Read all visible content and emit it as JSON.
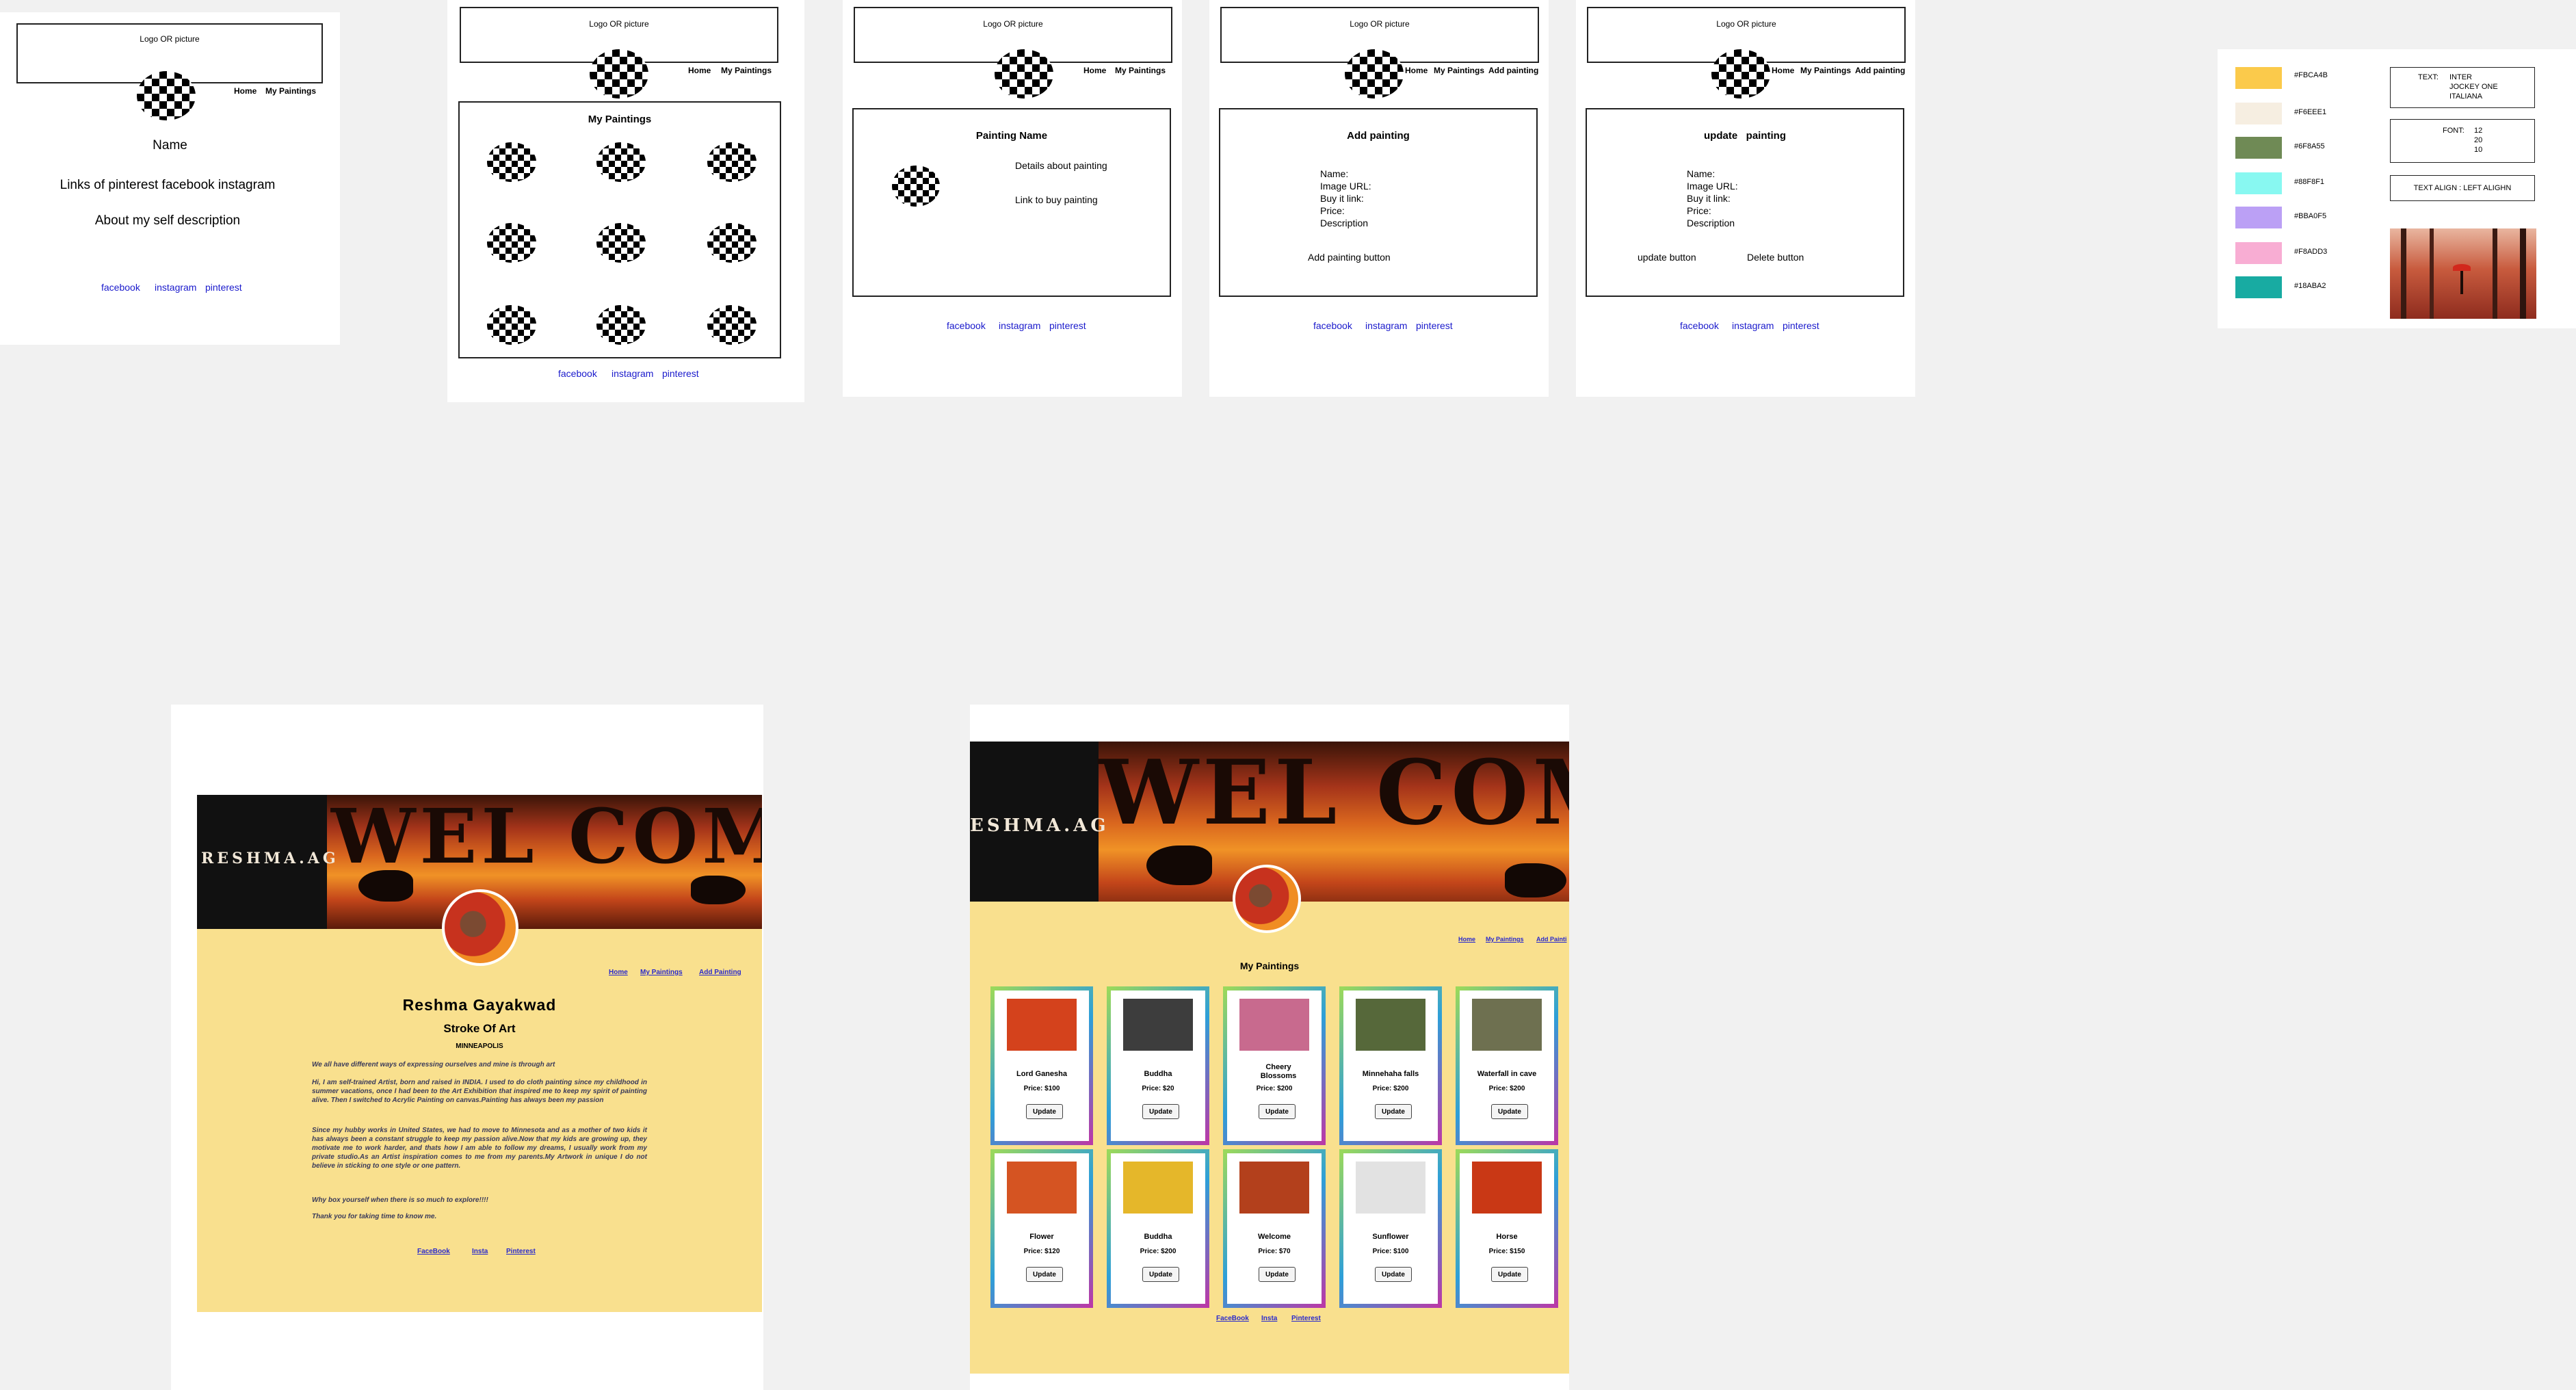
{
  "wire1": {
    "logo": "Logo OR picture",
    "nav": [
      "Home",
      "My Paintings"
    ],
    "name": "Name",
    "links_line": "Links of pinterest  facebook   instagram",
    "about": "About my self description",
    "footer": [
      "facebook",
      "instagram",
      "pinterest"
    ]
  },
  "wire2": {
    "logo": "Logo OR picture",
    "nav": [
      "Home",
      "My Paintings"
    ],
    "title": "My Paintings",
    "footer": [
      "facebook",
      "instagram",
      "pinterest"
    ]
  },
  "wire3": {
    "logo": "Logo OR picture",
    "nav": [
      "Home",
      "My Paintings"
    ],
    "title": "Painting  Name",
    "details": "Details about painting",
    "buy": "Link to buy painting",
    "footer": [
      "facebook",
      "instagram",
      "pinterest"
    ]
  },
  "wire4": {
    "logo": "Logo OR picture",
    "nav": [
      "Home",
      "My Paintings",
      "Add painting"
    ],
    "title": "Add painting",
    "fields": [
      "Name:",
      "Image URL:",
      "Buy it link:",
      "Price:",
      "Description"
    ],
    "button": "Add painting button",
    "footer": [
      "facebook",
      "instagram",
      "pinterest"
    ]
  },
  "wire5": {
    "logo": "Logo OR picture",
    "nav": [
      "Home",
      "My Paintings",
      "Add painting"
    ],
    "title": "update   painting",
    "fields": [
      "Name:",
      "Image URL:",
      "Buy it link:",
      "Price:",
      "Description"
    ],
    "update_button": "update button",
    "delete_button": "Delete button",
    "footer": [
      "facebook",
      "instagram",
      "pinterest"
    ]
  },
  "style_guide": {
    "colors": [
      {
        "hex": "#FBCA4B",
        "label": "#FBCA4B"
      },
      {
        "hex": "#F6EEE1",
        "label": "#F6EEE1"
      },
      {
        "hex": "#6F8A55",
        "label": "#6F8A55"
      },
      {
        "hex": "#88F8F1",
        "label": "#88F8F1"
      },
      {
        "hex": "#BBA0F5",
        "label": "#BBA0F5"
      },
      {
        "hex": "#F8ADD3",
        "label": "#F8ADD3"
      },
      {
        "hex": "#18ABA2",
        "label": "#18ABA2"
      }
    ],
    "text_box": {
      "label": "TEXT:",
      "lines": [
        "INTER",
        "JOCKEY ONE",
        "ITALIANA"
      ]
    },
    "font_box": {
      "label": "FONT:",
      "sizes": [
        "12",
        "20",
        "10"
      ]
    },
    "align_box": "TEXT ALIGN : LEFT ALIGHN"
  },
  "home_mock": {
    "bg": "#F9E08E",
    "brand": "RESHMA.AG",
    "welcome": "WEL COME",
    "nav": [
      "Home",
      "My Paintings",
      "Add Painting"
    ],
    "name": "Reshma Gayakwad",
    "tagline": "Stroke Of Art",
    "city": "MINNEAPOLIS",
    "paragraphs": [
      "We all have different ways of expressing ourselves and mine is through art",
      "Hi, I am self-trained Artist, born and raised in INDIA. I used to do cloth painting since my childhood in summer vacations, once I had been to the Art Exhibition that inspired me to keep my spirit of painting alive. Then I switched to Acrylic Painting on canvas.Painting has always been my passion",
      "Since my hubby works in United States, we had to move to Minnesota and as a mother of two kids it has always been a constant struggle to keep my passion alive.Now that my kids are growing up, they motivate me to work harder, and thats how I am able to follow my dreams, I usually work from my private studio.As an Artist inspiration comes to me from my parents.My Artwork in unique I do not believe in sticking to one style or one pattern.",
      "Why box yourself when there is so much to explore!!!!",
      "Thank you for taking time to know me."
    ],
    "footer": [
      "FaceBook",
      "Insta",
      "Pinterest"
    ]
  },
  "paintings_mock": {
    "bg": "#F9E08E",
    "brand": "ESHMA.AG",
    "welcome": "WEL COME",
    "nav": [
      "Home",
      "My Paintings",
      "Add Painti"
    ],
    "title": "My Paintings",
    "update_label": "Update",
    "cards": [
      {
        "name": "Lord Ganesha",
        "price": "Price: $100",
        "thumb": "#d4421c"
      },
      {
        "name": "Buddha",
        "price": "Price: $20",
        "thumb": "#3d3d3d"
      },
      {
        "name": "Cheery Blossoms",
        "price": "Price: $200",
        "thumb": "#c86a8e"
      },
      {
        "name": "Minnehaha falls",
        "price": "Price: $200",
        "thumb": "#56683a"
      },
      {
        "name": "Waterfall in cave",
        "price": "Price: $200",
        "thumb": "#6e7050"
      },
      {
        "name": "Flower",
        "price": "Price: $120",
        "thumb": "#d55422"
      },
      {
        "name": "Buddha",
        "price": "Price: $200",
        "thumb": "#e5b72a"
      },
      {
        "name": "Welcome",
        "price": "Price: $70",
        "thumb": "#b3401c"
      },
      {
        "name": "Sunflower",
        "price": "Price: $100",
        "thumb": "#e2e2e2"
      },
      {
        "name": "Horse",
        "price": "Price: $150",
        "thumb": "#c93815"
      }
    ],
    "footer": [
      "FaceBook",
      "Insta",
      "Pinterest"
    ]
  }
}
